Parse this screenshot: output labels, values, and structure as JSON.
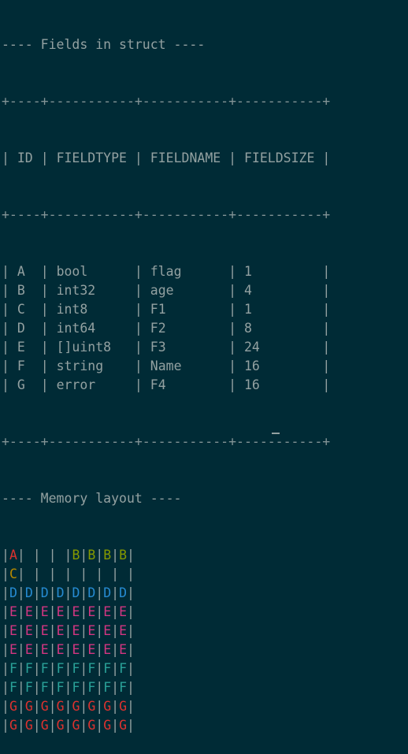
{
  "header1": "---- Fields in struct ----",
  "table": {
    "border_line": "+----+-----------+-----------+-----------+",
    "columns": [
      "ID",
      "FIELDTYPE",
      "FIELDNAME",
      "FIELDSIZE"
    ],
    "rows": [
      {
        "id": "A",
        "type": "bool",
        "name": "flag",
        "size": "1"
      },
      {
        "id": "B",
        "type": "int32",
        "name": "age",
        "size": "4"
      },
      {
        "id": "C",
        "type": "int8",
        "name": "F1",
        "size": "1"
      },
      {
        "id": "D",
        "type": "int64",
        "name": "F2",
        "size": "8"
      },
      {
        "id": "E",
        "type": "[]uint8",
        "name": "F3",
        "size": "24"
      },
      {
        "id": "F",
        "type": "string",
        "name": "Name",
        "size": "16"
      },
      {
        "id": "G",
        "type": "error",
        "name": "F4",
        "size": "16"
      }
    ]
  },
  "header2": "---- Memory layout ----",
  "memory": {
    "colors": {
      "A": "#dc322f",
      "B": "#859900",
      "C": "#b58900",
      "D": "#268bd2",
      "E": "#d33682",
      "F": "#2aa198",
      "G": "#dc322f",
      "separator": "#93a1a1"
    },
    "rows": [
      [
        "A",
        " ",
        " ",
        " ",
        "B",
        "B",
        "B",
        "B"
      ],
      [
        "C",
        " ",
        " ",
        " ",
        " ",
        " ",
        " ",
        " "
      ],
      [
        "D",
        "D",
        "D",
        "D",
        "D",
        "D",
        "D",
        "D"
      ],
      [
        "E",
        "E",
        "E",
        "E",
        "E",
        "E",
        "E",
        "E"
      ],
      [
        "E",
        "E",
        "E",
        "E",
        "E",
        "E",
        "E",
        "E"
      ],
      [
        "E",
        "E",
        "E",
        "E",
        "E",
        "E",
        "E",
        "E"
      ],
      [
        "F",
        "F",
        "F",
        "F",
        "F",
        "F",
        "F",
        "F"
      ],
      [
        "F",
        "F",
        "F",
        "F",
        "F",
        "F",
        "F",
        "F"
      ],
      [
        "G",
        "G",
        "G",
        "G",
        "G",
        "G",
        "G",
        "G"
      ],
      [
        "G",
        "G",
        "G",
        "G",
        "G",
        "G",
        "G",
        "G"
      ]
    ]
  }
}
